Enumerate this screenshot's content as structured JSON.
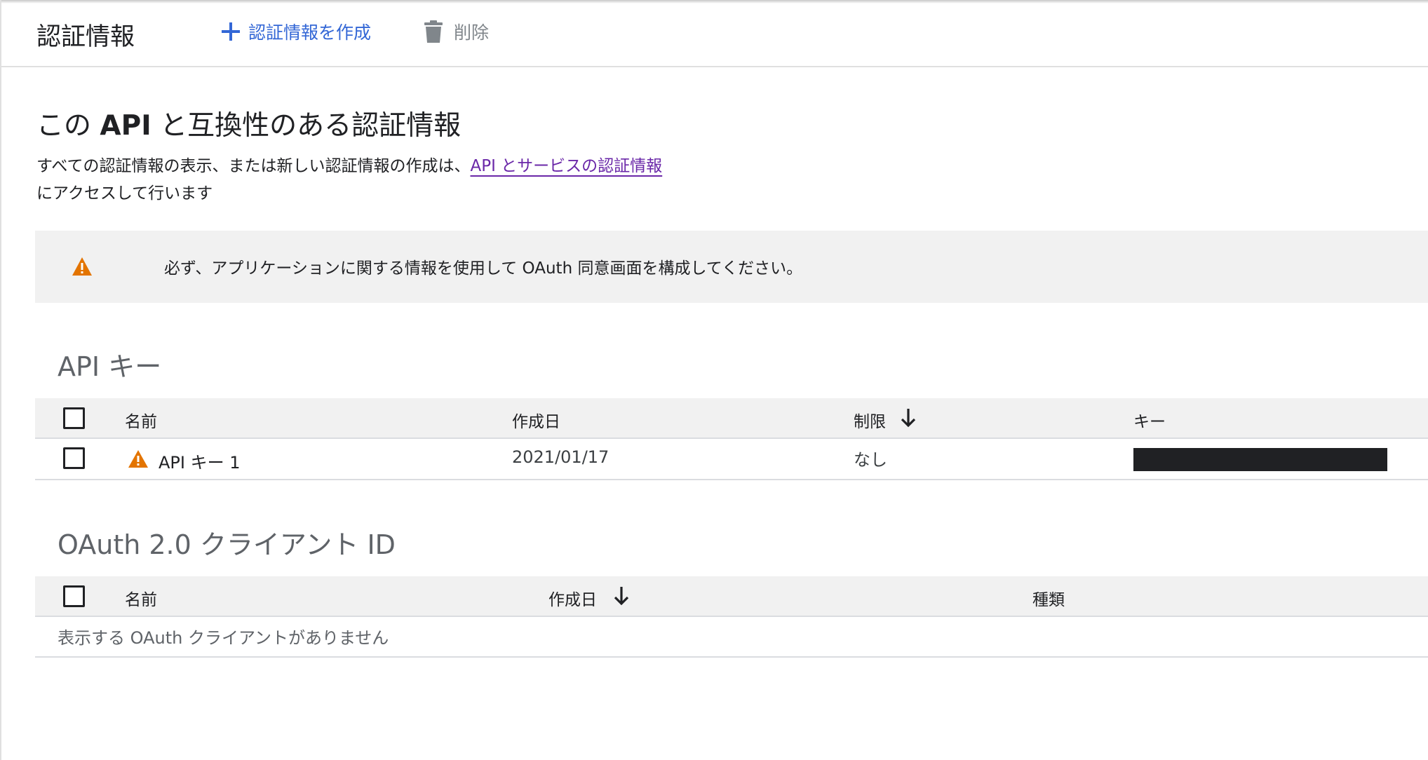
{
  "toolbar": {
    "title": "認証情報",
    "create_label": "認証情報を作成",
    "delete_label": "削除"
  },
  "header": {
    "heading_prefix": "この",
    "heading_bold": "API",
    "heading_suffix": "と互換性のある認証情報",
    "desc_text": "すべての認証情報の表示、または新しい認証情報の作成は、",
    "desc_link": "API とサービスの認証情報",
    "desc_text2": "にアクセスして行います"
  },
  "alert": {
    "text": "必ず、アプリケーションに関する情報を使用して OAuth 同意画面を構成してください。",
    "icon": "warning-icon",
    "icon_color": "#e37400"
  },
  "api_keys": {
    "title": "API キー",
    "columns": [
      "名前",
      "作成日",
      "制限",
      "キー"
    ],
    "sorted_column": "制限",
    "rows": [
      {
        "name": "API キー 1",
        "created": "2021/01/17",
        "restriction": "なし",
        "key": ""
      }
    ]
  },
  "oauth": {
    "title": "OAuth 2.0 クライアント ID",
    "columns": [
      "名前",
      "作成日",
      "種類"
    ],
    "sorted_column": "作成日",
    "empty_message": "表示する OAuth クライアントがありません"
  },
  "colors": {
    "accent": "#3367d6",
    "link": "#6a27a8",
    "warning": "#e37400",
    "muted": "#80868b"
  }
}
